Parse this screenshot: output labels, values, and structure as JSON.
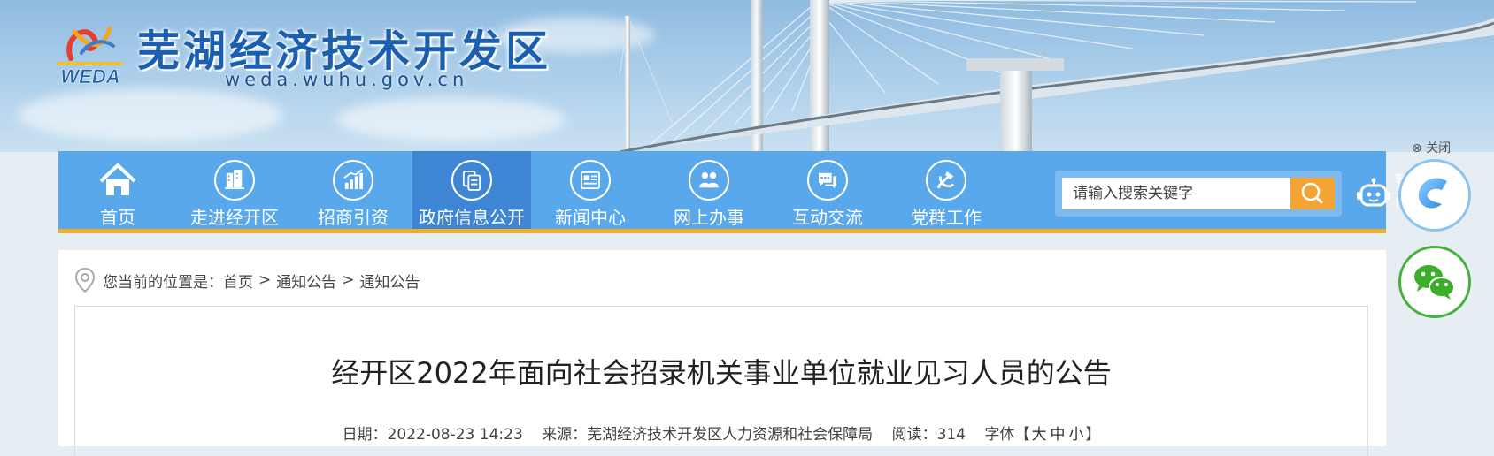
{
  "header": {
    "title": "芜湖经济技术开发区",
    "url": "weda.wuhu.gov.cn",
    "logo_text": "WEDA"
  },
  "nav": {
    "items": [
      {
        "label": "首页",
        "icon": "home-icon"
      },
      {
        "label": "走进经开区",
        "icon": "buildings-icon"
      },
      {
        "label": "招商引资",
        "icon": "bar-chart-icon"
      },
      {
        "label": "政府信息公开",
        "icon": "documents-icon",
        "active": true
      },
      {
        "label": "新闻中心",
        "icon": "newspaper-icon"
      },
      {
        "label": "网上办事",
        "icon": "people-icon"
      },
      {
        "label": "互动交流",
        "icon": "chat-icon"
      },
      {
        "label": "党群工作",
        "icon": "party-emblem-icon"
      }
    ],
    "search_placeholder": "请输入搜索关键字",
    "assistant_label": "智能问答"
  },
  "float": {
    "close_label": "关闭",
    "buttons": [
      "weibo-icon",
      "wechat-icon"
    ]
  },
  "breadcrumb": {
    "prefix": "您当前的位置是：",
    "items": [
      "首页",
      "通知公告",
      "通知公告"
    ],
    "separator": ">"
  },
  "article": {
    "title": "经开区2022年面向社会招录机关事业单位就业见习人员的公告",
    "date_label": "日期：",
    "date": "2022-08-23 14:23",
    "source_label": "来源：",
    "source": "芜湖经济技术开发区人力资源和社会保障局",
    "reads_label": "阅读：",
    "reads": "314",
    "font_label": "字体",
    "font_open": "【",
    "font_large": "大",
    "font_medium": "中",
    "font_small": "小",
    "font_close": "】"
  },
  "colors": {
    "nav_bg": "#59a8ec",
    "nav_active": "#3e86d4",
    "nav_border": "#f2ad2b",
    "search_button": "#f2a534",
    "title_blue": "#1b5fae"
  }
}
